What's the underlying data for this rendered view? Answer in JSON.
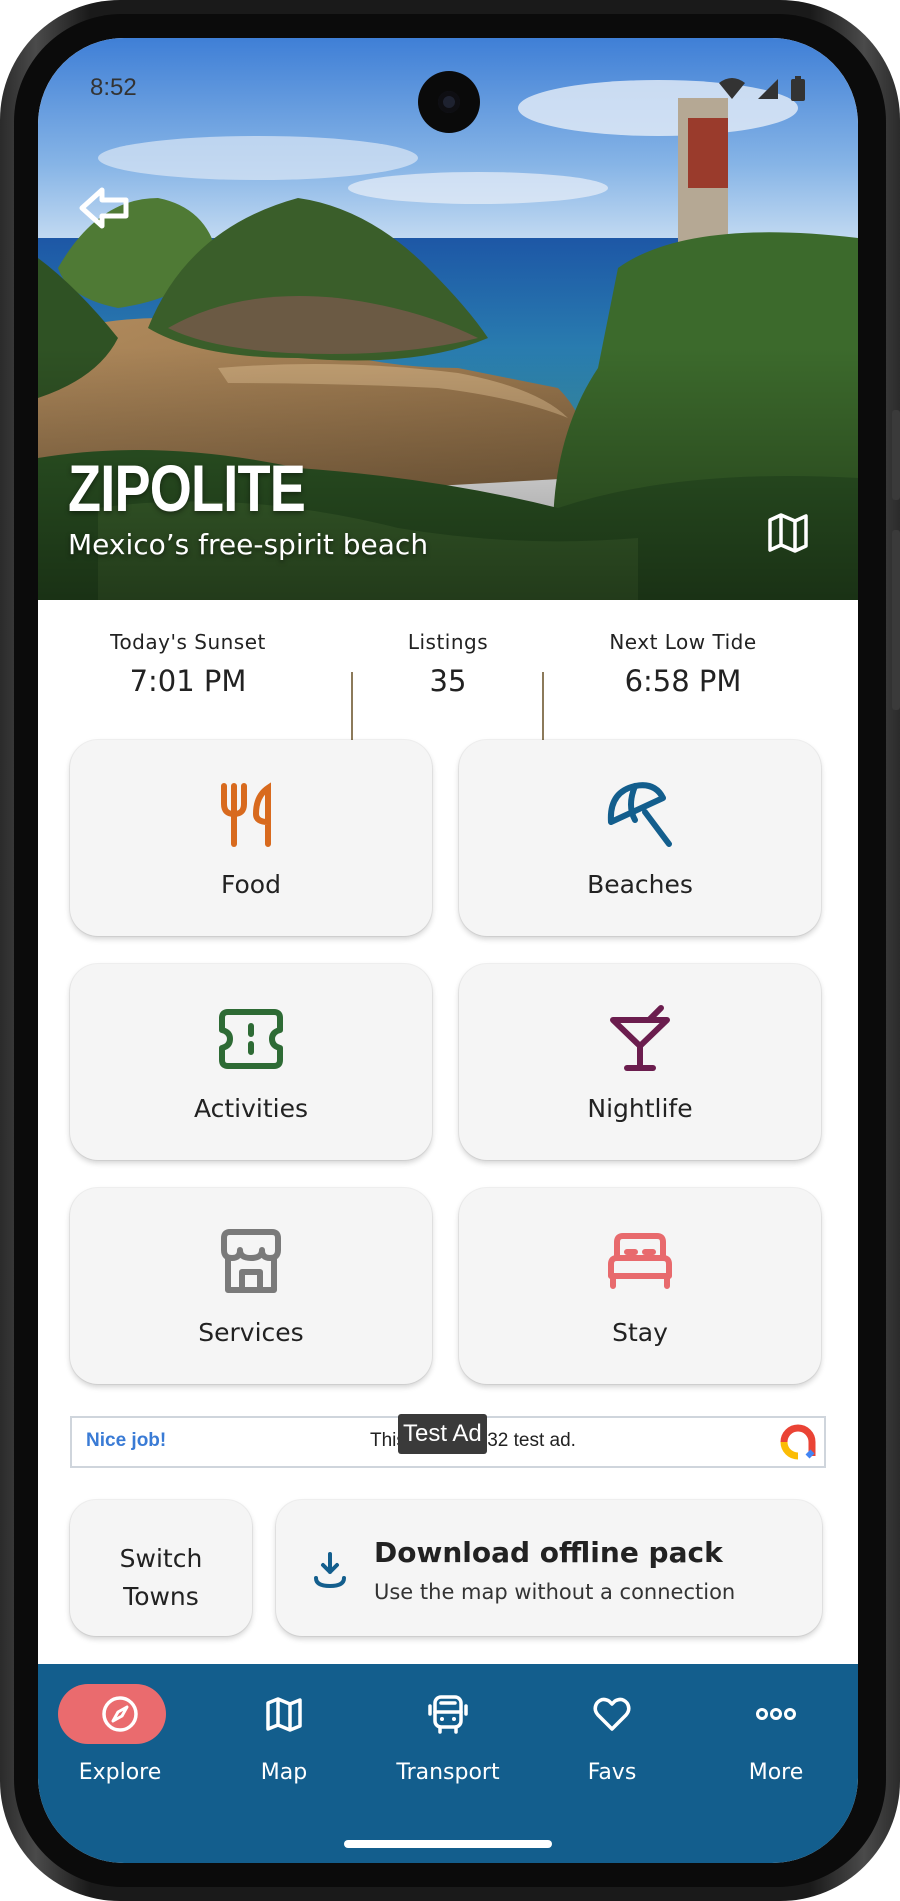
{
  "status_bar": {
    "time": "8:52"
  },
  "hero": {
    "title": "ZIPOLITE",
    "subtitle": "Mexico’s free-spirit beach"
  },
  "stats": [
    {
      "label": "Today's Sunset",
      "value": "7:01 PM"
    },
    {
      "label": "Listings",
      "value": "35"
    },
    {
      "label": "Next Low Tide",
      "value": "6:58 PM"
    }
  ],
  "categories": [
    {
      "label": "Food",
      "icon": "fork-knife-icon",
      "color": "#d86a1e"
    },
    {
      "label": "Beaches",
      "icon": "umbrella-icon",
      "color": "#135e8d"
    },
    {
      "label": "Activities",
      "icon": "ticket-icon",
      "color": "#2e6b35"
    },
    {
      "label": "Nightlife",
      "icon": "cocktail-icon",
      "color": "#6b1d4e"
    },
    {
      "label": "Services",
      "icon": "storefront-icon",
      "color": "#7a7a7a"
    },
    {
      "label": "Stay",
      "icon": "bed-icon",
      "color": "#e86a6d"
    }
  ],
  "ad": {
    "nice": "Nice job!",
    "text": "This is a 320x32 test ad.",
    "label": "Test Ad"
  },
  "switch_towns": {
    "label": "Switch\nTowns"
  },
  "offline": {
    "title": "Download offline pack",
    "subtitle": "Use the map without a connection"
  },
  "nav": {
    "items": [
      {
        "label": "Explore",
        "icon": "compass-icon",
        "active": true
      },
      {
        "label": "Map",
        "icon": "map-icon",
        "active": false
      },
      {
        "label": "Transport",
        "icon": "bus-icon",
        "active": false
      },
      {
        "label": "Favs",
        "icon": "heart-icon",
        "active": false
      },
      {
        "label": "More",
        "icon": "more-dots-icon",
        "active": false
      }
    ]
  },
  "colors": {
    "nav_bg": "#135e8d",
    "nav_active": "#ea6b6e",
    "tile_bg": "#f5f5f5"
  }
}
